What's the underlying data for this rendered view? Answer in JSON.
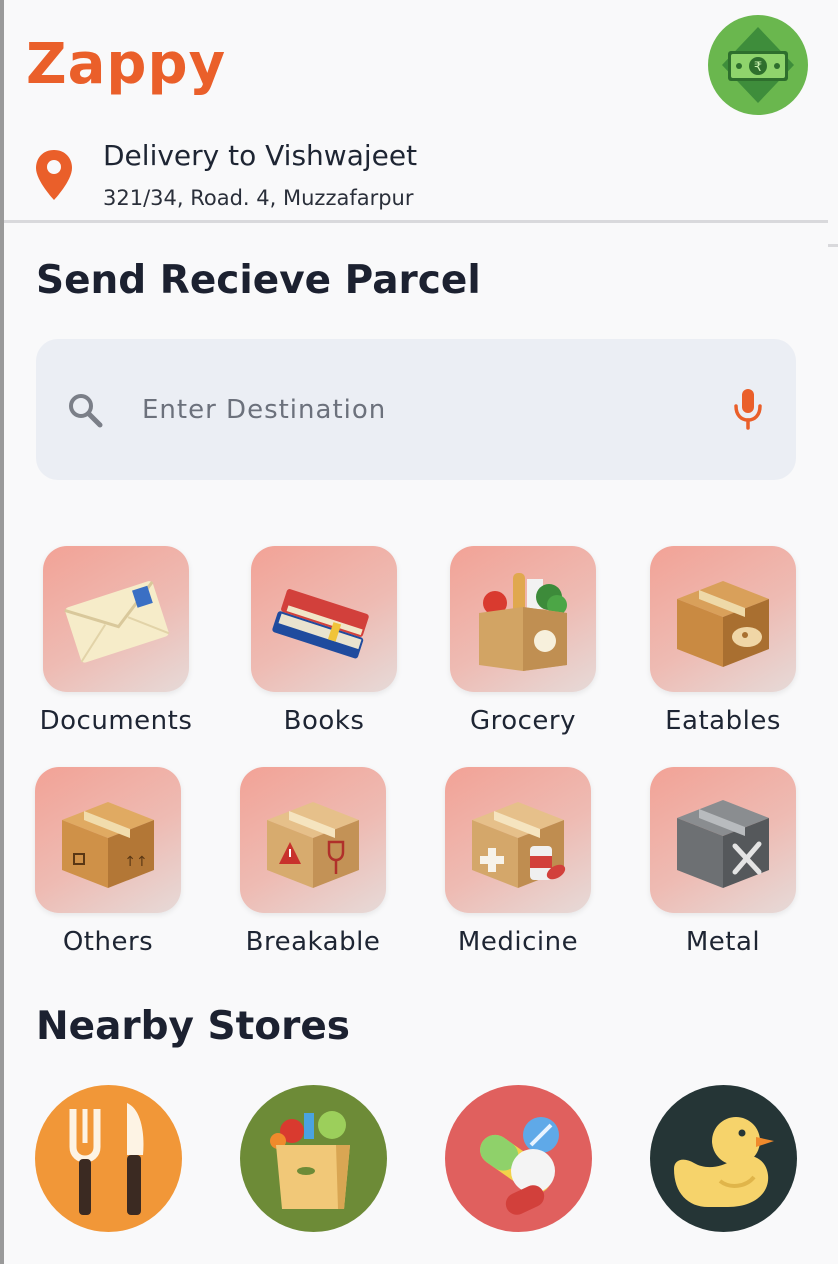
{
  "app": {
    "name": "Zappy"
  },
  "header": {
    "wallet_icon": "rupee-banknote-icon",
    "wallet_color": "#6ab74e"
  },
  "delivery": {
    "title": "Delivery to Vishwajeet",
    "address": "321/34, Road. 4, Muzzafarpur",
    "icon": "location-pin-icon"
  },
  "parcel": {
    "title": "Send Recieve Parcel",
    "search": {
      "placeholder": "Enter Destination",
      "value": ""
    },
    "categories": [
      {
        "label": "Documents",
        "icon": "envelope-icon"
      },
      {
        "label": "Books",
        "icon": "books-icon"
      },
      {
        "label": "Grocery",
        "icon": "grocery-box-icon"
      },
      {
        "label": "Eatables",
        "icon": "food-box-icon"
      },
      {
        "label": "Others",
        "icon": "cardboard-box-icon"
      },
      {
        "label": "Breakable",
        "icon": "fragile-box-icon"
      },
      {
        "label": "Medicine",
        "icon": "medicine-box-icon"
      },
      {
        "label": "Metal",
        "icon": "metal-box-icon"
      }
    ]
  },
  "stores": {
    "title": "Nearby Stores",
    "items": [
      {
        "icon": "fork-knife-icon",
        "color": "#f19738"
      },
      {
        "icon": "grocery-bag-icon",
        "color": "#6d8b37"
      },
      {
        "icon": "pills-icon",
        "color": "#e0605e"
      },
      {
        "icon": "rubber-duck-icon",
        "color": "#253536"
      }
    ]
  },
  "colors": {
    "accent": "#ea5f2a",
    "text": "#1e2533",
    "search_bg": "#ebeef4"
  }
}
